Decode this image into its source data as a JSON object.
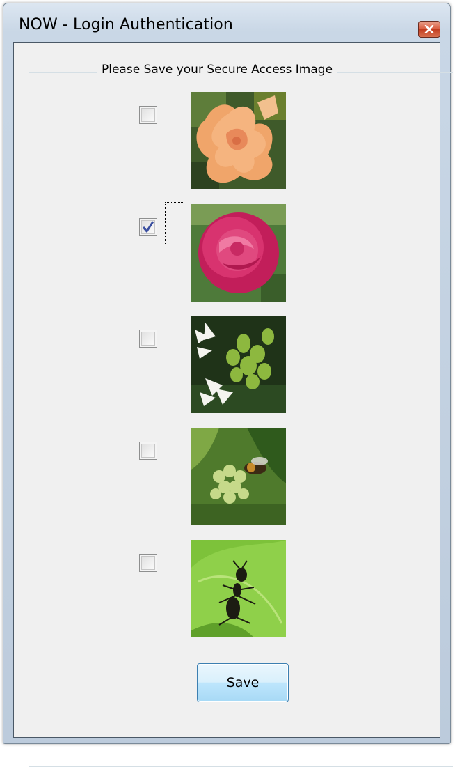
{
  "window": {
    "title": "NOW - Login Authentication"
  },
  "group": {
    "title": "Please Save your Secure Access Image"
  },
  "images": [
    {
      "name": "orange-flower",
      "checked": false
    },
    {
      "name": "pink-rose",
      "checked": true
    },
    {
      "name": "white-flowers-green-buds",
      "checked": false
    },
    {
      "name": "green-buds-with-bee",
      "checked": false
    },
    {
      "name": "ant-on-leaf",
      "checked": false
    }
  ],
  "buttons": {
    "save_label": "Save"
  },
  "colors": {
    "client_bg": "#f0f0f0",
    "close_button": "#c23c1f",
    "save_button_border": "#3c7fb1"
  }
}
